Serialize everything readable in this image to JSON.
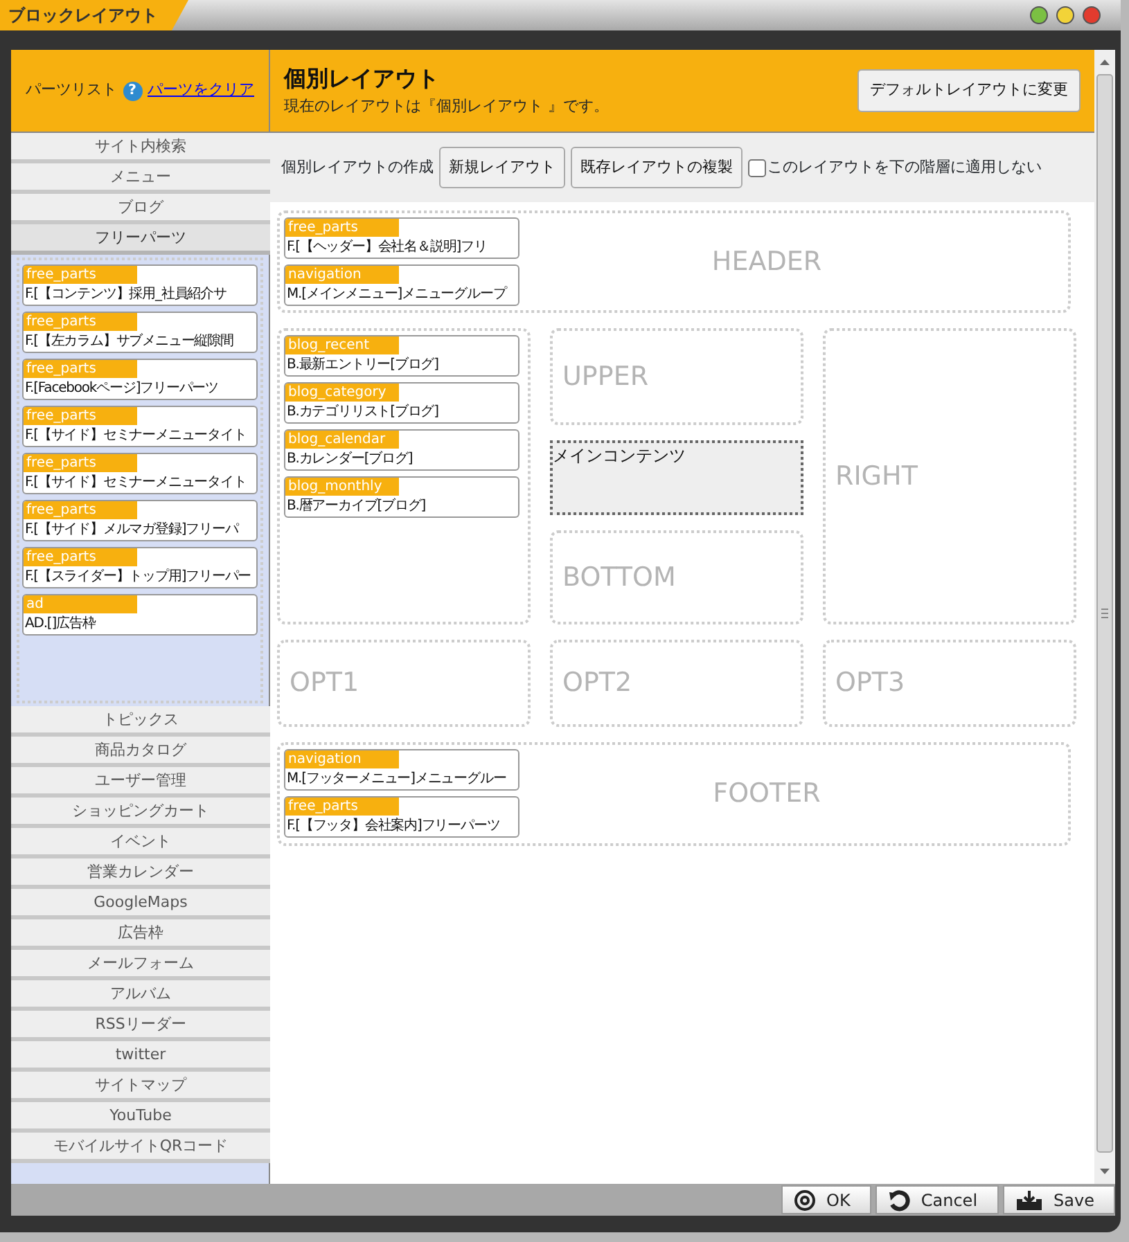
{
  "window": {
    "title": "ブロックレイアウト"
  },
  "parts_list": {
    "title": "パーツリスト",
    "help": "?",
    "clear_link": "パーツをクリア",
    "categories": [
      {
        "label": "サイト内検索",
        "expanded": false
      },
      {
        "label": "メニュー",
        "expanded": false
      },
      {
        "label": "ブログ",
        "expanded": false
      },
      {
        "label": "フリーパーツ",
        "expanded": true,
        "parts": [
          {
            "type": "free_parts",
            "name": "F.[【コンテンツ】採用_社員紹介サ"
          },
          {
            "type": "free_parts",
            "name": "F.[【左カラム】サブメニュー縦隙間"
          },
          {
            "type": "free_parts",
            "name": "F.[Facebookページ]フリーパーツ"
          },
          {
            "type": "free_parts",
            "name": "F.[【サイド】セミナーメニュータイト"
          },
          {
            "type": "free_parts",
            "name": "F.[【サイド】セミナーメニュータイト"
          },
          {
            "type": "free_parts",
            "name": "F.[【サイド】メルマガ登録]フリーパ"
          },
          {
            "type": "free_parts",
            "name": "F.[【スライダー】トップ用]フリーパー"
          },
          {
            "type": "ad",
            "name": "AD.[]広告枠"
          }
        ]
      },
      {
        "label": "トピックス",
        "expanded": false
      },
      {
        "label": "商品カタログ",
        "expanded": false
      },
      {
        "label": "ユーザー管理",
        "expanded": false
      },
      {
        "label": "ショッピングカート",
        "expanded": false
      },
      {
        "label": "イベント",
        "expanded": false
      },
      {
        "label": "営業カレンダー",
        "expanded": false
      },
      {
        "label": "GoogleMaps",
        "expanded": false
      },
      {
        "label": "広告枠",
        "expanded": false
      },
      {
        "label": "メールフォーム",
        "expanded": false
      },
      {
        "label": "アルバム",
        "expanded": false
      },
      {
        "label": "RSSリーダー",
        "expanded": false
      },
      {
        "label": "twitter",
        "expanded": false
      },
      {
        "label": "サイトマップ",
        "expanded": false
      },
      {
        "label": "YouTube",
        "expanded": false
      },
      {
        "label": "モバイルサイトQRコード",
        "expanded": false
      }
    ]
  },
  "layout": {
    "title": "個別レイアウト",
    "description": "現在のレイアウトは『個別レイアウト 』です。",
    "default_button": "デフォルトレイアウトに変更",
    "create_label": "個別レイアウトの作成",
    "new_button": "新規レイアウト",
    "copy_button": "既存レイアウトの複製",
    "no_inherit": {
      "label": "このレイアウトを下の階層に適用しない",
      "checked": false
    },
    "areas": {
      "header": {
        "label": "HEADER",
        "parts": [
          {
            "type": "free_parts",
            "name": "F.[【ヘッダー】会社名＆説明]フリ"
          },
          {
            "type": "navigation",
            "name": "M.[メインメニュー]メニューグループ"
          }
        ]
      },
      "left": {
        "parts": [
          {
            "type": "blog_recent",
            "name": "B.最新エントリー[ブログ]"
          },
          {
            "type": "blog_category",
            "name": "B.カテゴリリスト[ブログ]"
          },
          {
            "type": "blog_calendar",
            "name": "B.カレンダー[ブログ]"
          },
          {
            "type": "blog_monthly",
            "name": "B.暦アーカイブ[ブログ]"
          }
        ]
      },
      "upper": {
        "label": "UPPER"
      },
      "main": {
        "label": "メインコンテンツ"
      },
      "bottom": {
        "label": "BOTTOM"
      },
      "right": {
        "label": "RIGHT"
      },
      "opt1": {
        "label": "OPT1"
      },
      "opt2": {
        "label": "OPT2"
      },
      "opt3": {
        "label": "OPT3"
      },
      "footer": {
        "label": "FOOTER",
        "parts": [
          {
            "type": "navigation",
            "name": "M.[フッターメニュー]メニューグルー"
          },
          {
            "type": "free_parts",
            "name": "F.[【フッタ】会社案内]フリーパーツ"
          }
        ]
      }
    }
  },
  "buttons": [
    {
      "label": "OK",
      "kind": "ok"
    },
    {
      "label": "Cancel",
      "kind": "cancel"
    },
    {
      "label": "Save",
      "kind": "save"
    }
  ]
}
